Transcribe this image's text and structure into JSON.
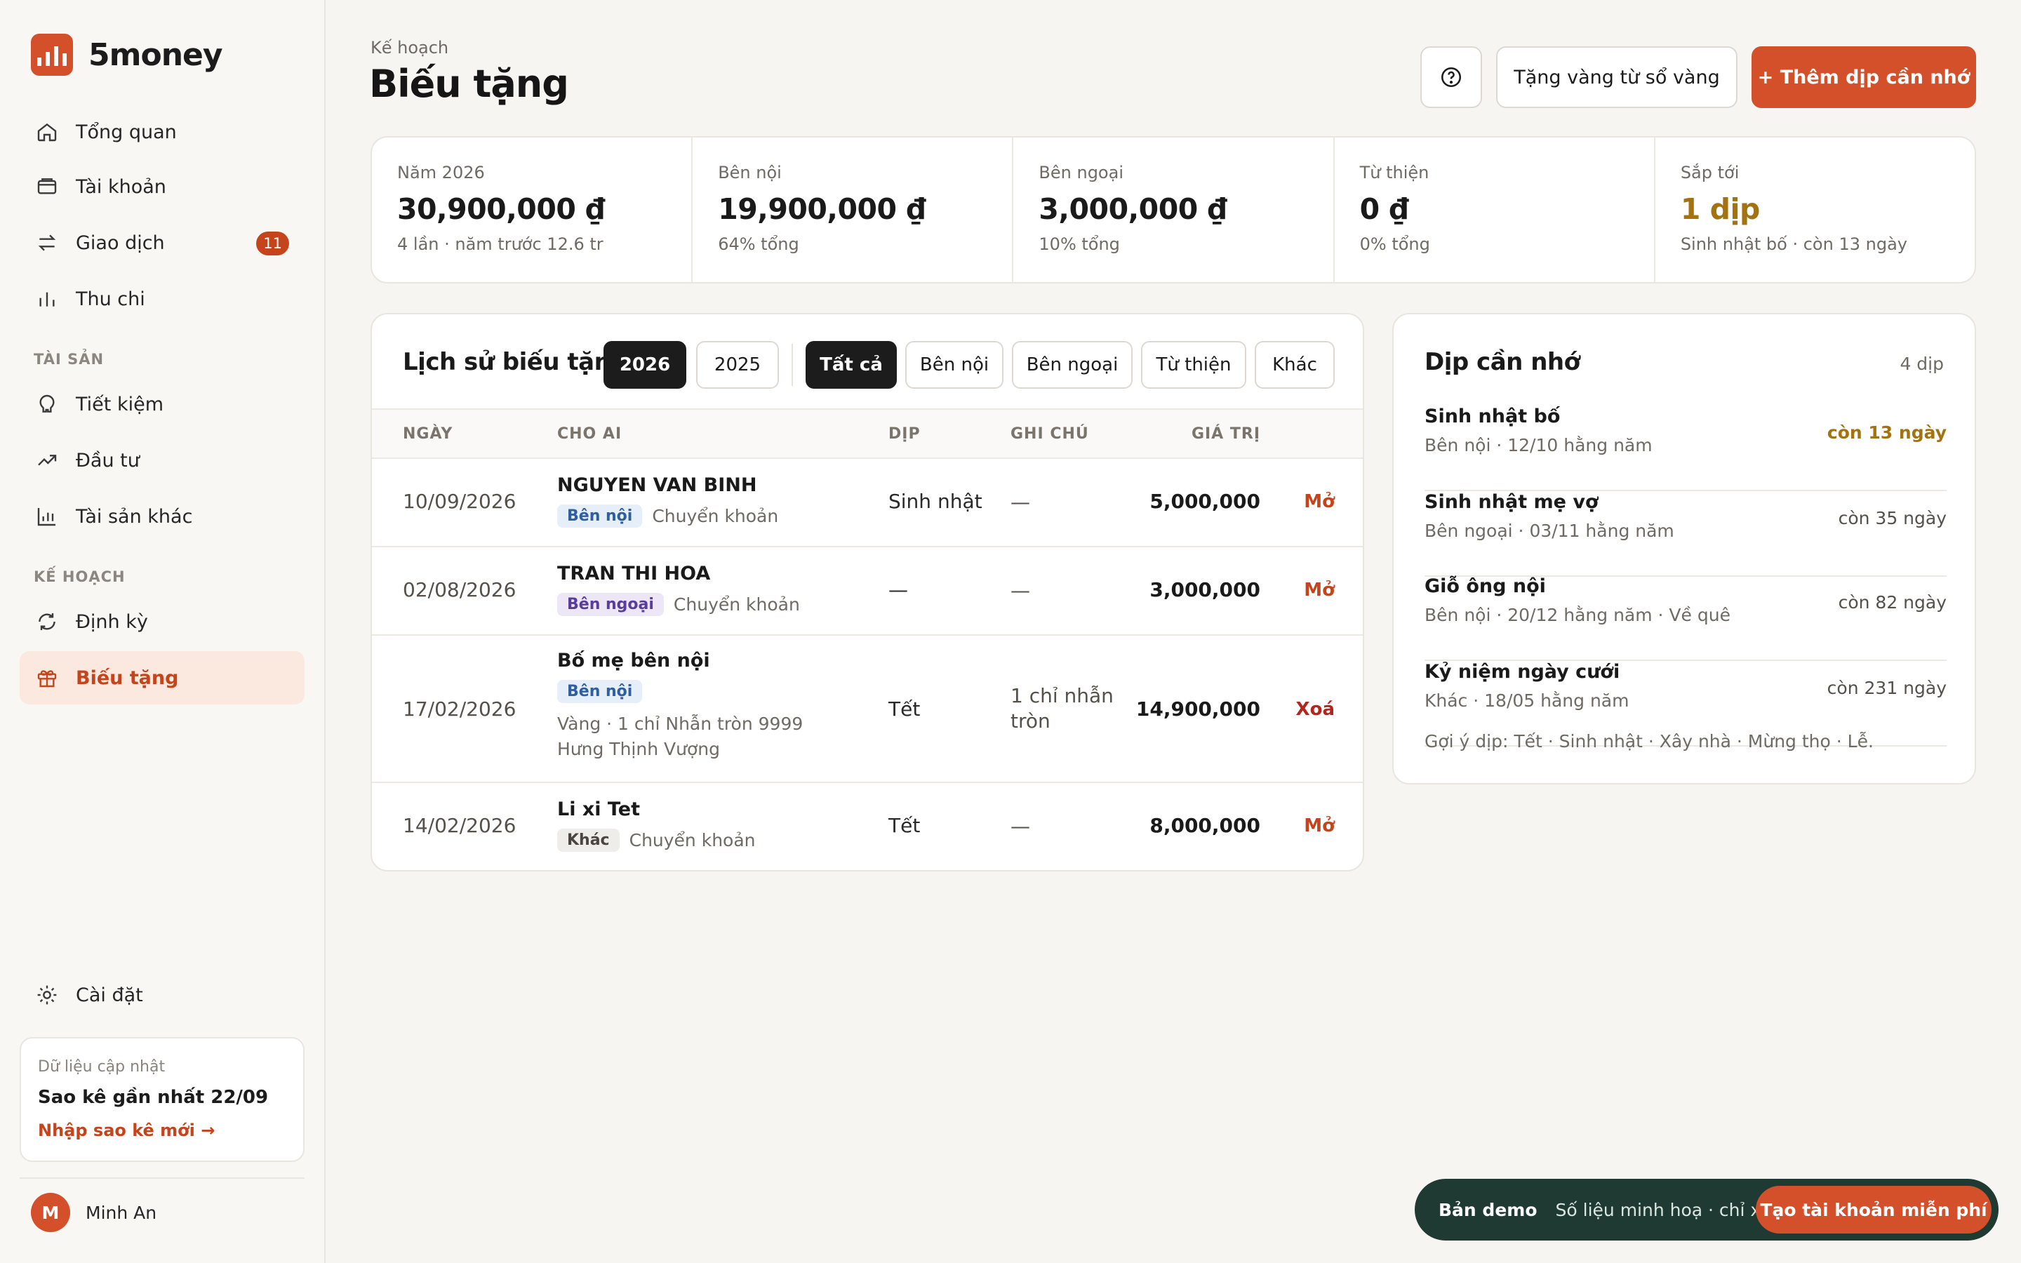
{
  "brand": {
    "name": "5money",
    "accent": "#d4502a"
  },
  "sidebar": {
    "nav_main": [
      {
        "label": "Tổng quan",
        "icon": "home-icon"
      },
      {
        "label": "Tài khoản",
        "icon": "wallet-icon"
      },
      {
        "label": "Giao dịch",
        "icon": "swap-icon",
        "badge": "11"
      },
      {
        "label": "Thu chi",
        "icon": "bar-chart-icon"
      }
    ],
    "section_assets": "TÀI SẢN",
    "nav_assets": [
      {
        "label": "Tiết kiệm",
        "icon": "piggy-bank-icon"
      },
      {
        "label": "Đầu tư",
        "icon": "trend-up-icon"
      },
      {
        "label": "Tài sản khác",
        "icon": "chart-column-icon"
      }
    ],
    "section_plan": "KẾ HOẠCH",
    "nav_plan": [
      {
        "label": "Định kỳ",
        "icon": "refresh-icon"
      },
      {
        "label": "Biếu tặng",
        "icon": "gift-icon",
        "active": true
      }
    ],
    "settings": {
      "label": "Cài đặt",
      "icon": "sun-gear-icon"
    },
    "update_card": {
      "label": "Dữ liệu cập nhật",
      "value": "Sao kê gần nhất 22/09",
      "action": "Nhập sao kê mới →"
    },
    "user": {
      "initial": "M",
      "name": "Minh An"
    }
  },
  "header": {
    "breadcrumb": "Kế hoạch",
    "title": "Biếu tặng",
    "gold_button": "Tặng vàng từ sổ vàng",
    "add_button": "+ Thêm dịp cần nhớ"
  },
  "stats": [
    {
      "label": "Năm 2026",
      "value": "30,900,000 ₫",
      "sub": "4 lần · năm trước 12.6 tr"
    },
    {
      "label": "Bên nội",
      "value": "19,900,000 ₫",
      "sub": "64% tổng"
    },
    {
      "label": "Bên ngoại",
      "value": "3,000,000 ₫",
      "sub": "10% tổng"
    },
    {
      "label": "Từ thiện",
      "value": "0 ₫",
      "sub": "0% tổng"
    },
    {
      "label": "Sắp tới",
      "value": "1 dịp",
      "sub": "Sinh nhật bố · còn 13 ngày"
    }
  ],
  "history": {
    "title": "Lịch sử biếu tặng",
    "years": [
      "2026",
      "2025"
    ],
    "filters": [
      "Tất cả",
      "Bên nội",
      "Bên ngoại",
      "Từ thiện",
      "Khác"
    ],
    "columns": {
      "date": "NGÀY",
      "who": "CHO AI",
      "occasion": "DỊP",
      "note": "GHI CHÚ",
      "value": "GIÁ TRỊ"
    },
    "rows": [
      {
        "date": "10/09/2026",
        "who": "NGUYEN VAN BINH",
        "tag": "Bên nội",
        "method": "Chuyển khoản",
        "extra": "",
        "occasion": "Sinh nhật",
        "note": "—",
        "value": "5,000,000",
        "action": "Mở"
      },
      {
        "date": "02/08/2026",
        "who": "TRAN THI HOA",
        "tag": "Bên ngoại",
        "method": "Chuyển khoản",
        "extra": "",
        "occasion": "—",
        "note": "—",
        "value": "3,000,000",
        "action": "Mở"
      },
      {
        "date": "17/02/2026",
        "who": "Bố mẹ bên nội",
        "tag": "Bên nội",
        "method": "",
        "extra": "Vàng · 1 chỉ Nhẫn tròn 9999 Hưng Thịnh Vượng",
        "occasion": "Tết",
        "note": "1 chỉ nhẫn tròn",
        "value": "14,900,000",
        "action": "Xoá"
      },
      {
        "date": "14/02/2026",
        "who": "Li xi Tet",
        "tag": "Khác",
        "method": "Chuyển khoản",
        "extra": "",
        "occasion": "Tết",
        "note": "—",
        "value": "8,000,000",
        "action": "Mở"
      }
    ]
  },
  "reminders": {
    "title": "Dịp cần nhớ",
    "count": "4 dịp",
    "items": [
      {
        "name": "Sinh nhật bố",
        "sub": "Bên nội · 12/10 hằng năm",
        "left": "còn 13 ngày"
      },
      {
        "name": "Sinh nhật mẹ vợ",
        "sub": "Bên ngoại · 03/11 hằng năm",
        "left": "còn 35 ngày"
      },
      {
        "name": "Giỗ ông nội",
        "sub": "Bên nội · 20/12 hằng năm · Về quê",
        "left": "còn 82 ngày"
      },
      {
        "name": "Kỷ niệm ngày cưới",
        "sub": "Khác · 18/05 hằng năm",
        "left": "còn 231 ngày"
      }
    ],
    "hint": "Gợi ý dịp: Tết · Sinh nhật · Xây nhà · Mừng thọ · Lễ."
  },
  "demo": {
    "label": "Bản demo",
    "text": "Số liệu minh hoạ · chỉ xem",
    "cta": "Tạo tài khoản miễn phí"
  }
}
